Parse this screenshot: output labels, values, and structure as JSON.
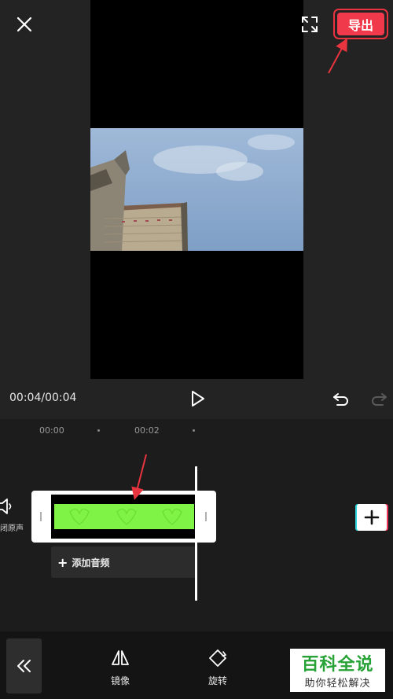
{
  "header": {
    "close_icon": "close-icon",
    "fullscreen_icon": "fullscreen-icon",
    "export_label": "导出"
  },
  "player": {
    "time": "00:04/00:04"
  },
  "timeline": {
    "ruler": [
      "00:00",
      "00:02"
    ],
    "mute_label": "闭原声",
    "add_audio_label": "添加音频"
  },
  "toolbar": {
    "items": [
      {
        "label": "镜像",
        "icon": "mirror-icon"
      },
      {
        "label": "旋转",
        "icon": "rotate-icon"
      }
    ]
  },
  "watermark": {
    "title": "百科全说",
    "subtitle": "助你轻松解决"
  },
  "colors": {
    "accent": "#f03a4b",
    "clip_fill": "#7ff446",
    "annotation": "#e8343f",
    "watermark_green": "#27a236"
  }
}
